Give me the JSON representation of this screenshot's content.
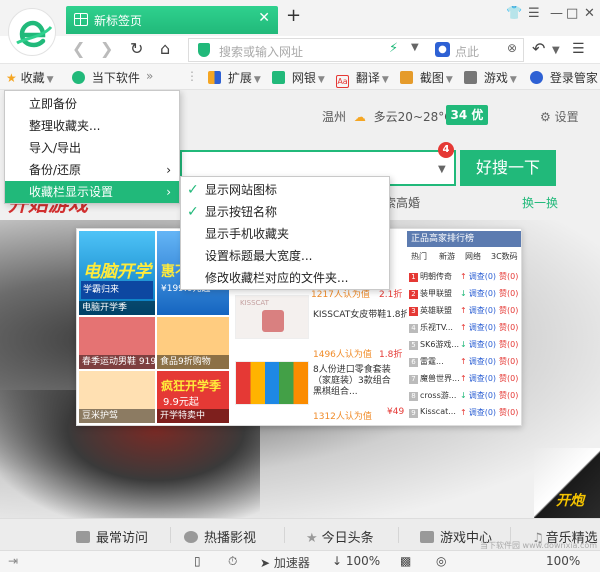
{
  "tab": {
    "title": "新标签页",
    "close": "✕",
    "new_tab": "+"
  },
  "window_controls": {
    "skin": "👕",
    "menu": "☰",
    "minimize": "—",
    "maximize": "□",
    "close": "✕"
  },
  "address_bar": {
    "placeholder": "搜索或输入网址",
    "suggestion": "点此",
    "icons": [
      "back-icon",
      "forward-icon",
      "refresh-icon",
      "home-icon",
      "shield-icon",
      "lightning-icon",
      "baidu-paw-icon",
      "close-icon",
      "undo-icon",
      "menu-icon"
    ]
  },
  "bookmark_bar": {
    "favorites": "收藏",
    "download_software": "当下软件",
    "more": "»",
    "extensions": "扩展",
    "bank": "网银",
    "translate": "翻译",
    "screenshot": "截图",
    "games": "游戏",
    "login": "登录管家"
  },
  "favorites_menu": {
    "items": [
      "立即备份",
      "整理收藏夹...",
      "导入/导出",
      "备份/还原",
      "收藏栏显示设置"
    ],
    "selected_index": 4
  },
  "display_submenu": {
    "items": [
      {
        "label": "显示网站图标",
        "checked": true
      },
      {
        "label": "显示按钮名称",
        "checked": true
      },
      {
        "label": "显示手机收藏夹",
        "checked": false
      },
      {
        "label": "设置标题最大宽度...",
        "checked": false
      },
      {
        "label": "修改收藏栏对应的文件夹...",
        "checked": false
      }
    ]
  },
  "header": {
    "city": "温州",
    "weather": "多云20~28°C",
    "aqi": "34 优",
    "settings": "设置"
  },
  "search": {
    "badge": "4",
    "button": "好搜一下",
    "hot_text": "票中奖遭索高婚",
    "swap": "换一换"
  },
  "promo_banner": {
    "title": "开始游戏"
  },
  "ads": {
    "tiles": [
      {
        "caption": "电脑开学季"
      },
      {
        "caption": "春季运动男鞋 919..."
      },
      {
        "caption": "食品9折购物"
      },
      {
        "caption": "豆米护驾"
      },
      {
        "caption": "开学特卖中"
      }
    ],
    "tile_headline": "电脑开学",
    "tile_sub1": "学霸归来",
    "tile_sub2": "惠不可挡",
    "tile_price": "¥199.0元起",
    "autumn_headline": "疯狂开学季",
    "autumn_price": "9.9元起",
    "products": [
      {
        "name": "",
        "buyers": "1217人认为值",
        "price": "2.1折"
      },
      {
        "name": "KISSCAT女皮带鞋1.8折起",
        "buyers": "1496人认为值",
        "price": "1.8折"
      },
      {
        "name": "8人份进口零食套装（家庭装）3款组合 黑棋组合...",
        "buyers": "1312人认为值",
        "price": "¥49"
      }
    ],
    "product_brand": "KISSCAT",
    "price_dup": "¥49",
    "price_tag": "¥",
    "rank": {
      "title": "正品高家排行榜",
      "tabs": [
        "热门",
        "新游",
        "网络",
        "3C数码"
      ],
      "rows": [
        {
          "name": "明朝传奇",
          "value": "调查(0)",
          "fav": "赞(0)"
        },
        {
          "name": "装甲联盟",
          "value": "调查(0)",
          "fav": "赞(0)"
        },
        {
          "name": "英雄联盟",
          "value": "调查(0)",
          "fav": "赞(0)"
        },
        {
          "name": "乐视TV...",
          "value": "调查(0)",
          "fav": "赞(0)"
        },
        {
          "name": "SK6游戏...",
          "value": "调查(0)",
          "fav": "赞(0)"
        },
        {
          "name": "雷霆...",
          "value": "调查(0)",
          "fav": "赞(0)"
        },
        {
          "name": "魔兽世界...",
          "value": "调查(0)",
          "fav": "赞(0)"
        },
        {
          "name": "cross游...",
          "value": "调查(0)",
          "fav": "赞(0)"
        },
        {
          "name": "Kisscat...",
          "value": "调查(0)",
          "fav": "赞(0)"
        }
      ]
    }
  },
  "corner_badge": "开炮",
  "dock": [
    "最常访问",
    "热播影视",
    "今日头条",
    "游戏中心",
    "音乐精选"
  ],
  "dock_icons": [
    "grid-icon",
    "play-icon",
    "star-icon",
    "gamepad-icon",
    "music-icon"
  ],
  "statusbar": {
    "accelerator": "加速器",
    "download_zoom": "100%",
    "zoom": "100%"
  },
  "watermark": "当下软件园 www.downxia.com",
  "colors": {
    "accent": "#21b97a",
    "badge_red": "#e53935",
    "menu_select": "#21b97a"
  }
}
